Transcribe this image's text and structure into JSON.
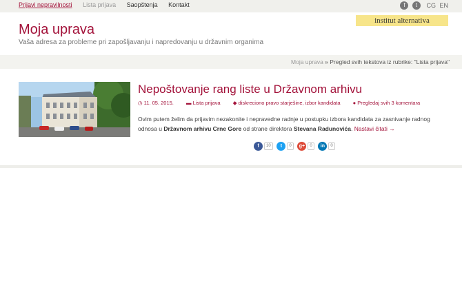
{
  "nav": {
    "items": [
      {
        "label": "Prijavi nepravilnosti",
        "state": "active"
      },
      {
        "label": "Lista prijava",
        "state": "muted"
      },
      {
        "label": "Saopštenja",
        "state": "normal"
      },
      {
        "label": "Kontakt",
        "state": "normal"
      }
    ]
  },
  "social": {
    "facebook_icon": "f",
    "twitter_icon": "t",
    "lang_cg": "CG",
    "lang_en": "EN"
  },
  "header": {
    "title": "Moja uprava",
    "subtitle": "Vaša adresa za probleme pri zapošljavanju i napredovanju u državnim organima",
    "badge": "institut alternativa"
  },
  "breadcrumb": {
    "home": "Moja uprava",
    "sep": " » ",
    "current": "Pregled svih tekstova iz rubrike: \"Lista prijava\""
  },
  "post": {
    "title": "Nepoštovanje rang liste u Državnom arhivu",
    "date": "11. 05. 2015.",
    "category": "Lista prijava",
    "tags": "diskreciono pravo starješine, izbor kandidata",
    "comments": "Pregledaj svih 3 komentara",
    "excerpt_1": "Ovim putem želim da prijavim nezakonite i nepravedne radnje u postupku izbora kandidata za zasnivanje radnog odnosa u ",
    "excerpt_bold1": "Državnom arhivu Crne Gore",
    "excerpt_2": " od strane direktora ",
    "excerpt_bold2": "Stevana Radunovića",
    "excerpt_3": ". ",
    "read_more": "Nastavi čitati →"
  },
  "shares": [
    {
      "network": "facebook",
      "icon": "f",
      "count": "10",
      "color": "#3b5998"
    },
    {
      "network": "twitter",
      "icon": "t",
      "count": "0",
      "color": "#1da1f2"
    },
    {
      "network": "google-plus",
      "icon": "g+",
      "count": "0",
      "color": "#dd4b39"
    },
    {
      "network": "linkedin",
      "icon": "in",
      "count": "0",
      "color": "#0077b5"
    }
  ],
  "colors": {
    "accent": "#a3123a",
    "badge": "#f7e58a"
  }
}
